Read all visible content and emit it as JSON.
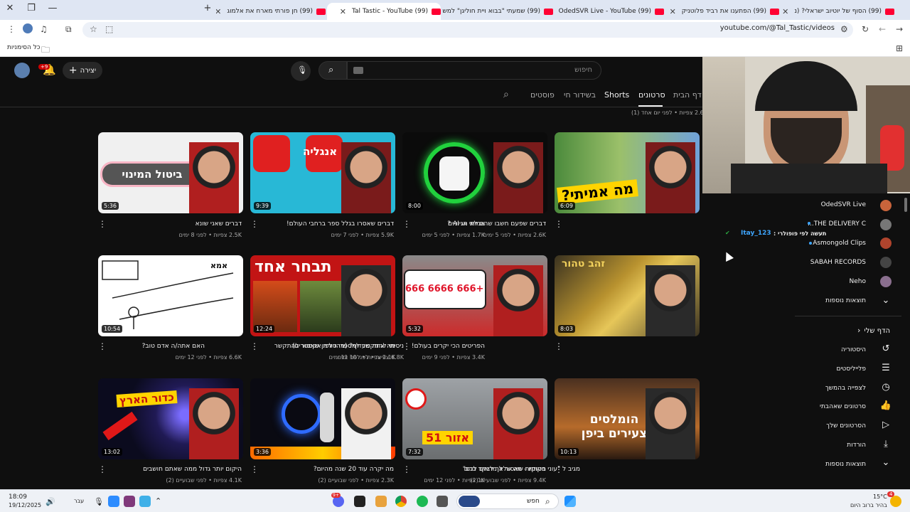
{
  "browser": {
    "tabs": [
      {
        "title": "(99) הסוף של יוטיוב ישראלי? (נ"
      },
      {
        "title": "(99) הפתענו את רביד פלוטניק"
      },
      {
        "title": "(99) OdedSVR Live - YouTube"
      },
      {
        "title": "(99) שמעתי \"בבוא ויית חוליגן\" למש"
      },
      {
        "title": "(99) Tal Tastic - YouTube"
      },
      {
        "title": "(99) חן פורתי מארח את אלמוג"
      }
    ],
    "url": "youtube.com/@Tal_Tastic/videos",
    "bookmarks_label": "כל הסימניות"
  },
  "yt": {
    "search_placeholder": "חיפוש",
    "create_label": "יצירה",
    "notif_count": "+9",
    "tabs": [
      "דף הבית",
      "סרטונים",
      "Shorts",
      "בשידור חי",
      "פוסטים"
    ],
    "top_meta": "2.6K צפיות • לפני יום אחד (1)",
    "videos": [
      {
        "title": "אמיתי או AI ?",
        "meta": "1.7K צפיות • לפני 5 ימים",
        "duration": "6:09",
        "thumb_text": "מה אמיתי?"
      },
      {
        "title": "דברים שפעם חשבו שהם לא הגיוניים",
        "meta": "2.6K צפיות • לפני 5 ימים",
        "duration": "8:00",
        "thumb_text": ""
      },
      {
        "title": "דברים שאסרו בגלל ספר ברחבי העולם!",
        "meta": "5.9K צפיות • לפני 7 ימים",
        "duration": "9:39",
        "thumb_text": "אנגליה"
      },
      {
        "title": "דברים שאני שונא",
        "meta": "2.5K צפיות • לפני 8 ימים",
        "duration": "5:36",
        "thumb_text": "ביטול המינוי"
      },
      {
        "title": "הפריטים הכי יקרים בעולם!",
        "meta": "3.4K צפיות • לפני 9 ימים",
        "duration": "8:03",
        "thumb_text": "זהב טהור"
      },
      {
        "title": "ניסיתי להתקשר למספרי טלפון שאסור להתקשר",
        "meta": "6.8K צפיות • לפני 10 ימים",
        "duration": "5:32",
        "thumb_text": "+666 6666 666"
      },
      {
        "title": "מה אתה מעדיף? (מהדורת אקסטרים)",
        "meta": "2.1K צפיות • לפני 11 ימים",
        "duration": "12:24",
        "thumb_text": "תבחר אחד"
      },
      {
        "title": "האם אתה/ה אדם טוב?",
        "meta": "6.6K צפיות • לפני 12 ימים",
        "duration": "10:54",
        "thumb_text": "אמא"
      },
      {
        "title": "מגיב ל \"עוני בטוקיו - מה שלא מראים לכם\"",
        "meta": "1K צפיות • לפני 12 ימים",
        "duration": "10:13",
        "thumb_text": "הומלסים צעירים ביפן"
      },
      {
        "title": "מקומות שאסור לך לבקר בהם",
        "meta": "9.4K צפיות • לפני שבועיים (2)",
        "duration": "7:32",
        "thumb_text": "אזור 51"
      },
      {
        "title": "מה יקרה עוד 20 שנה מהיום?",
        "meta": "2.3K צפיות • לפני שבועיים (2)",
        "duration": "3:36",
        "thumb_text": ""
      },
      {
        "title": "היקום יותר גדול ממה שאתם חושבים",
        "meta": "4.1K צפיות • לפני שבועיים (2)",
        "duration": "13:02",
        "thumb_text": "כדור הארץ"
      }
    ]
  },
  "sidebar": {
    "subs": [
      {
        "name": "OdedSVR Live",
        "color": "#c9643b"
      },
      {
        "name": "THE DELIVERY C...",
        "color": "#777777"
      },
      {
        "name": "Asmongold Clips",
        "color": "#b0442d"
      },
      {
        "name": "SABAH RECORDS",
        "color": "#444444"
      },
      {
        "name": "Neho",
        "color": "#8a6f8e"
      }
    ],
    "show_more": "תוצאות נוספות",
    "chat_user": "Itay_123",
    "chat_text": "תעשה לפי פופולרי :",
    "my_section": "הדף שלי",
    "my_items": [
      "היסטוריה",
      "פלייליסטים",
      "לצפייה בהמשך",
      "סרטונים שאהבתי",
      "הסרטונים שלך",
      "הורדות",
      "תוצאות נוספות"
    ]
  },
  "taskbar": {
    "time": "18:09",
    "date": "19/12/2025",
    "lang": "עבר",
    "search": "חפש",
    "weather_temp": "15°C",
    "weather_desc": "בהיר ברוב היום",
    "notif": "4"
  },
  "colors": {
    "accent": "#ff0033",
    "bg": "#0f0f0f",
    "chrome": "#dfe6f3"
  }
}
